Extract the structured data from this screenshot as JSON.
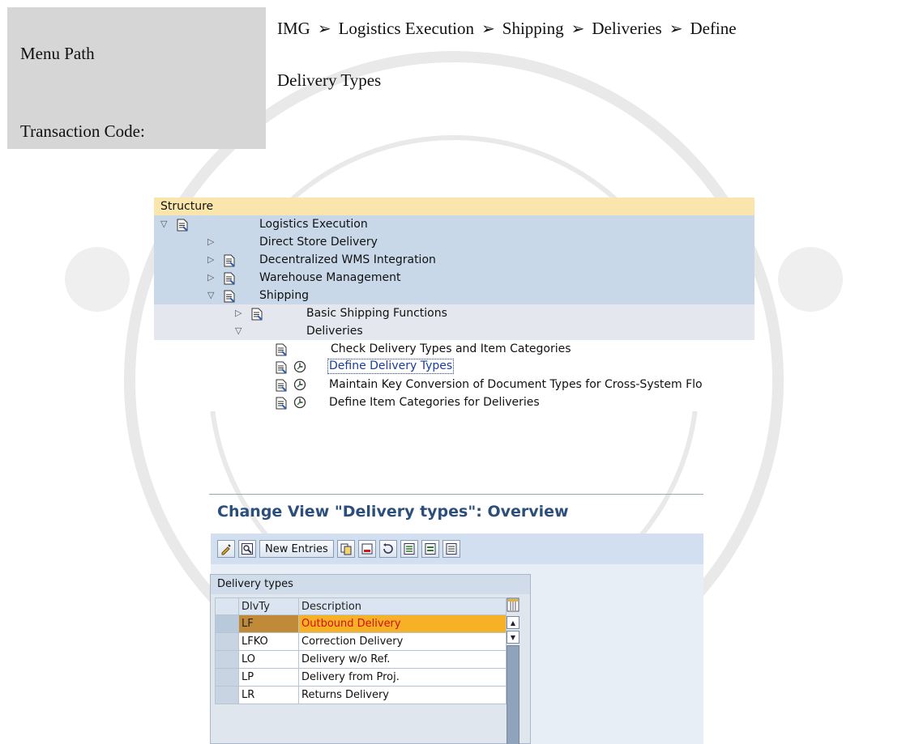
{
  "header": {
    "menu_path_label": "Menu Path",
    "transaction_code_label": "Transaction Code:",
    "path_items": [
      "IMG",
      "Logistics Execution",
      "Shipping",
      "Deliveries",
      "Define"
    ],
    "path_continuation": "Delivery Types",
    "path_separator_icon": "right-arrowhead-icon"
  },
  "tree": {
    "header": "Structure",
    "nodes": [
      {
        "label": "Logistics Execution",
        "expander": "expanded"
      },
      {
        "label": "Direct Store Delivery",
        "expander": "collapsed"
      },
      {
        "label": "Decentralized WMS Integration",
        "expander": "collapsed"
      },
      {
        "label": "Warehouse Management",
        "expander": "collapsed"
      },
      {
        "label": "Shipping",
        "expander": "expanded"
      },
      {
        "label": "Basic Shipping Functions",
        "expander": "collapsed"
      },
      {
        "label": "Deliveries",
        "expander": "expanded"
      },
      {
        "label": "Check Delivery Types and Item Categories"
      },
      {
        "label": "Define Delivery Types",
        "selected": true
      },
      {
        "label": "Maintain Key Conversion of Document Types for Cross-System Flo"
      },
      {
        "label": "Define Item Categories for Deliveries"
      }
    ]
  },
  "change_view": {
    "title": "Change View \"Delivery types\": Overview",
    "toolbar": {
      "new_entries_label": "New Entries",
      "icons": [
        "display-change-icon",
        "details-icon",
        "copy-icon",
        "delete-icon",
        "undo-icon",
        "select-all-icon",
        "select-block-icon",
        "deselect-all-icon"
      ]
    },
    "table": {
      "caption": "Delivery types",
      "columns": [
        "DlvTy",
        "Description"
      ],
      "rows": [
        {
          "code": "LF",
          "description": "Outbound Delivery",
          "highlighted": true
        },
        {
          "code": "LFKO",
          "description": "Correction Delivery"
        },
        {
          "code": "LO",
          "description": "Delivery w/o Ref."
        },
        {
          "code": "LP",
          "description": "Delivery from Proj."
        },
        {
          "code": "LR",
          "description": "Returns Delivery"
        }
      ]
    }
  }
}
